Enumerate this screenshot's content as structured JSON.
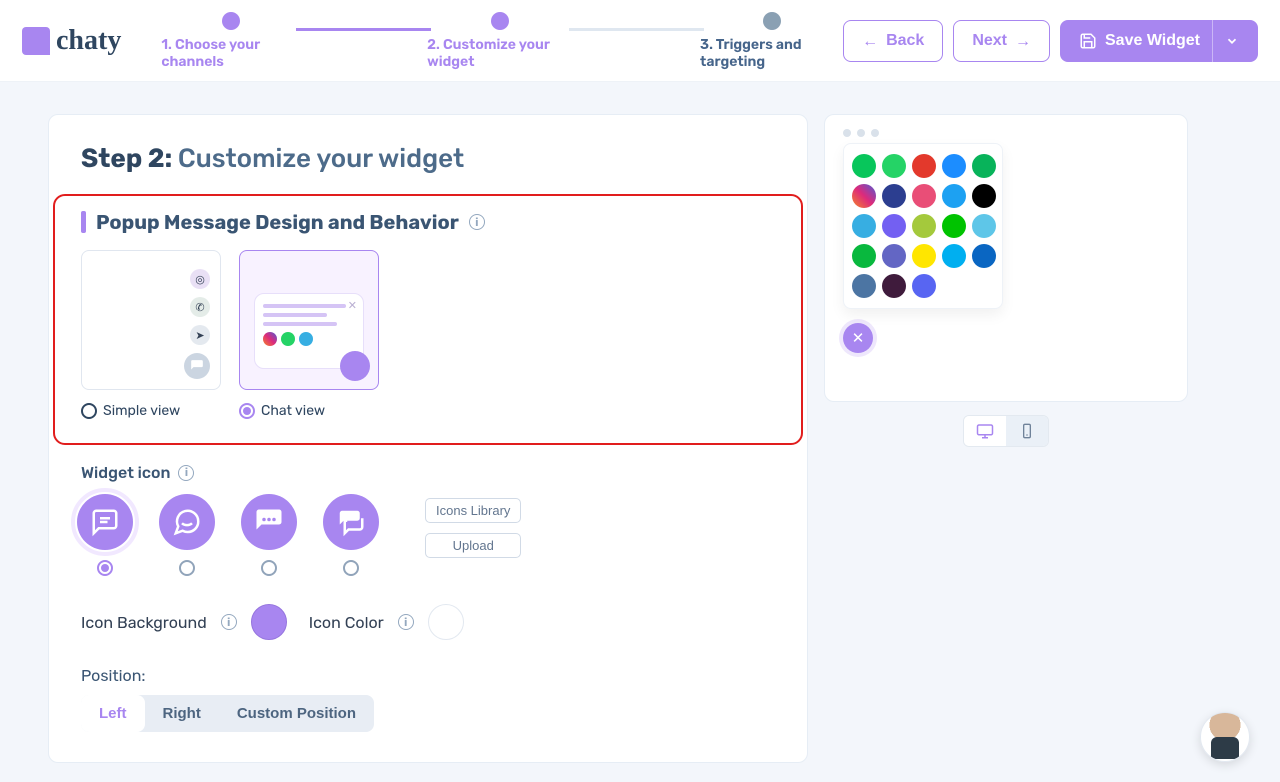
{
  "brand": {
    "name": "chaty"
  },
  "stepper": {
    "steps": [
      {
        "label": "1. Choose your channels",
        "state": "done"
      },
      {
        "label": "2. Customize your widget",
        "state": "done"
      },
      {
        "label": "3. Triggers and targeting",
        "state": "current"
      }
    ]
  },
  "nav": {
    "back": "Back",
    "next": "Next",
    "save": "Save Widget"
  },
  "heading": {
    "step_prefix": "Step 2:",
    "title": "Customize your widget"
  },
  "popup_section": {
    "title": "Popup Message Design and Behavior",
    "options": {
      "simple": "Simple view",
      "chat": "Chat view"
    },
    "selected": "chat"
  },
  "widget_icon": {
    "label": "Widget icon",
    "buttons": {
      "library": "Icons Library",
      "upload": "Upload"
    },
    "selected_index": 0
  },
  "colors": {
    "icon_bg_label": "Icon Background",
    "icon_color_label": "Icon Color",
    "icon_bg_value": "#A886F0",
    "icon_color_value": "#FFFFFF"
  },
  "position": {
    "label": "Position:",
    "options": [
      "Left",
      "Right",
      "Custom Position"
    ],
    "selected": "Left"
  },
  "preview": {
    "device_selected": "mobile",
    "channels": [
      {
        "name": "phone",
        "bg": "#08C65B"
      },
      {
        "name": "whatsapp",
        "bg": "#25D366"
      },
      {
        "name": "email",
        "bg": "#E3392C"
      },
      {
        "name": "messenger",
        "bg": "#1C8DFF"
      },
      {
        "name": "location",
        "bg": "#08B35A"
      },
      {
        "name": "instagram",
        "bg": "linear-gradient(45deg,#F58529,#DD2A7B,#515BD4)"
      },
      {
        "name": "contact",
        "bg": "#2C3E90"
      },
      {
        "name": "sms",
        "bg": "#E94E77"
      },
      {
        "name": "twitter",
        "bg": "#1DA1F2"
      },
      {
        "name": "tiktok",
        "bg": "#000000"
      },
      {
        "name": "telegram",
        "bg": "#37AEE2"
      },
      {
        "name": "viber",
        "bg": "#7360F2"
      },
      {
        "name": "custom-msg",
        "bg": "#A4C93C"
      },
      {
        "name": "line",
        "bg": "#00C300"
      },
      {
        "name": "chat",
        "bg": "#5EC6E8"
      },
      {
        "name": "wechat",
        "bg": "#09B83E"
      },
      {
        "name": "teams",
        "bg": "#6366C4"
      },
      {
        "name": "snapchat",
        "bg": "#FFE600"
      },
      {
        "name": "skype",
        "bg": "#00AFF0"
      },
      {
        "name": "linkedin",
        "bg": "#0A66C2"
      },
      {
        "name": "vk",
        "bg": "#4C75A3"
      },
      {
        "name": "slack",
        "bg": "#3F1B3C"
      },
      {
        "name": "discord",
        "bg": "#5865F2"
      }
    ]
  }
}
